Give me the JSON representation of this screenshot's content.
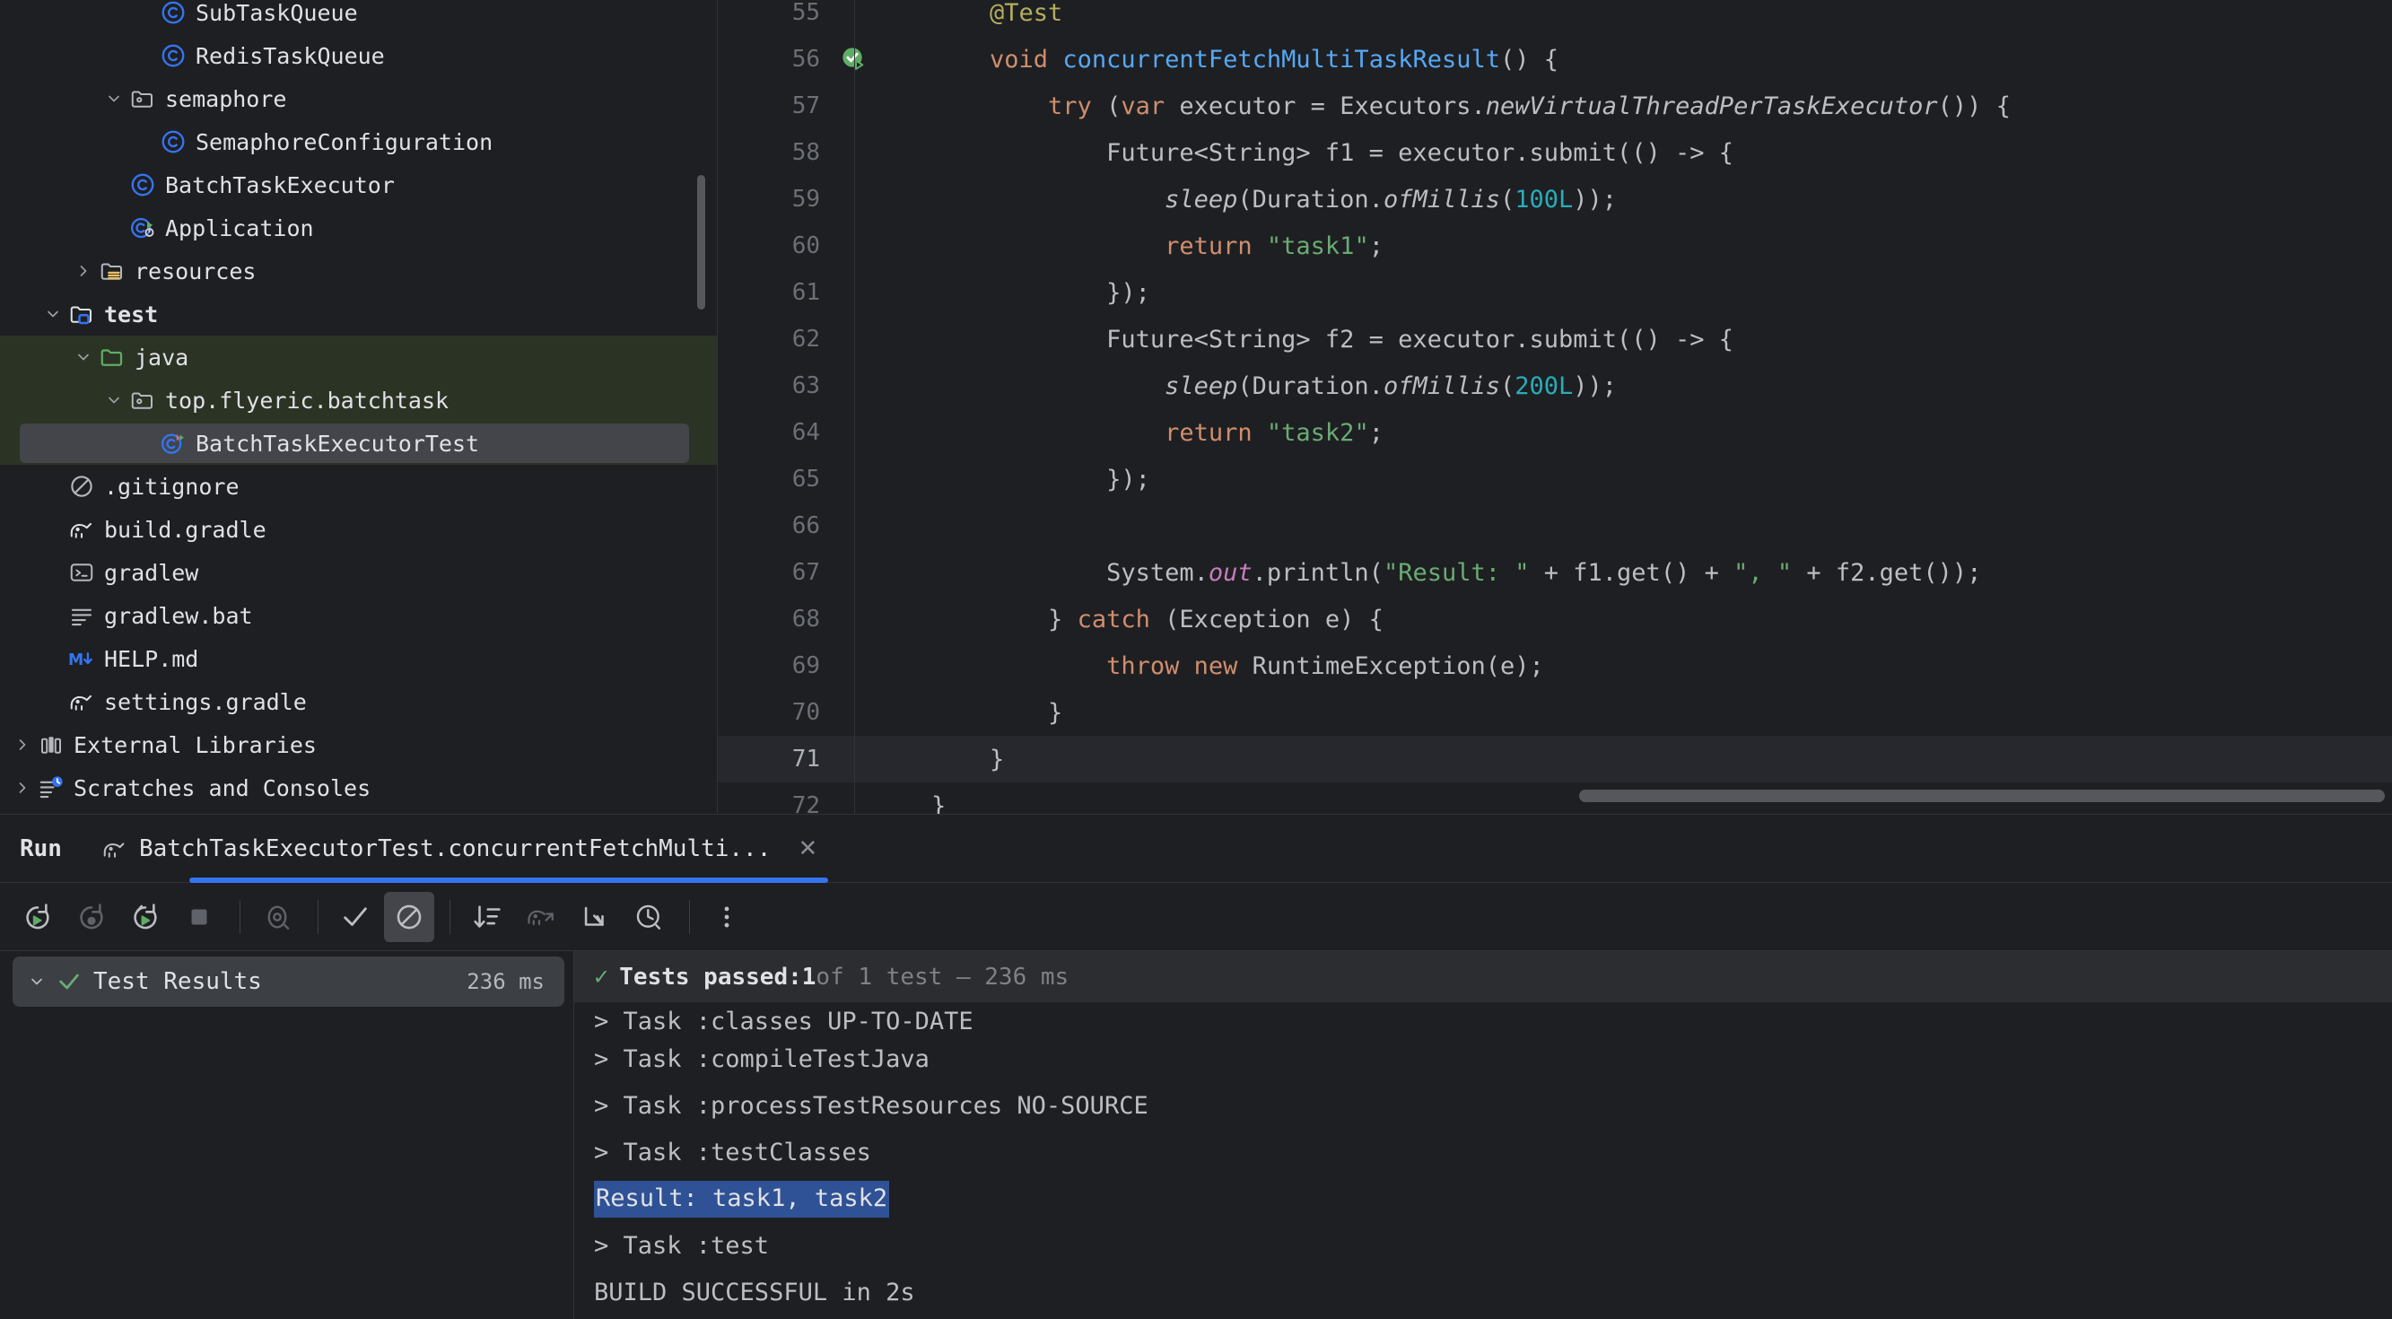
{
  "project_tree": {
    "items": [
      {
        "indent": 4,
        "arrow": "none",
        "icon": "class-icon",
        "label": "SubTaskQueue",
        "state": "normal",
        "clipped": true
      },
      {
        "indent": 4,
        "arrow": "none",
        "icon": "class-icon",
        "label": "RedisTaskQueue",
        "state": "normal"
      },
      {
        "indent": 3,
        "arrow": "down",
        "icon": "package-folder-icon",
        "label": "semaphore",
        "state": "normal"
      },
      {
        "indent": 4,
        "arrow": "none",
        "icon": "class-icon",
        "label": "SemaphoreConfiguration",
        "state": "normal"
      },
      {
        "indent": 3,
        "arrow": "none",
        "icon": "class-icon",
        "label": "BatchTaskExecutor",
        "state": "normal"
      },
      {
        "indent": 3,
        "arrow": "none",
        "icon": "runnable-class-icon",
        "label": "Application",
        "state": "normal"
      },
      {
        "indent": 2,
        "arrow": "right",
        "icon": "resources-folder-icon",
        "label": "resources",
        "state": "normal"
      },
      {
        "indent": 1,
        "arrow": "down",
        "icon": "test-source-folder-icon",
        "label": "test",
        "state": "bold"
      },
      {
        "indent": 2,
        "arrow": "down",
        "icon": "test-java-folder-icon",
        "label": "java",
        "state": "green-row"
      },
      {
        "indent": 3,
        "arrow": "down",
        "icon": "package-folder-icon",
        "label": "top.flyeric.batchtask",
        "state": "green-row"
      },
      {
        "indent": 4,
        "arrow": "none",
        "icon": "test-class-icon",
        "label": "BatchTaskExecutorTest",
        "state": "selected"
      },
      {
        "indent": 1,
        "arrow": "none",
        "icon": "gitignore-icon",
        "label": ".gitignore",
        "state": "normal"
      },
      {
        "indent": 1,
        "arrow": "none",
        "icon": "gradle-icon",
        "label": "build.gradle",
        "state": "normal"
      },
      {
        "indent": 1,
        "arrow": "none",
        "icon": "shell-script-icon",
        "label": "gradlew",
        "state": "normal"
      },
      {
        "indent": 1,
        "arrow": "none",
        "icon": "text-file-icon",
        "label": "gradlew.bat",
        "state": "normal"
      },
      {
        "indent": 1,
        "arrow": "none",
        "icon": "markdown-icon",
        "label": "HELP.md",
        "state": "normal"
      },
      {
        "indent": 1,
        "arrow": "none",
        "icon": "gradle-icon",
        "label": "settings.gradle",
        "state": "normal"
      },
      {
        "indent": 0,
        "arrow": "right",
        "icon": "external-libraries-icon",
        "label": "External Libraries",
        "state": "normal"
      },
      {
        "indent": 0,
        "arrow": "right",
        "icon": "scratches-icon",
        "label": "Scratches and Consoles",
        "state": "normal"
      }
    ]
  },
  "editor": {
    "lines": [
      {
        "num": "55",
        "gutter": "none",
        "current": false,
        "clipped_top": true,
        "tokens": [
          {
            "t": "    ",
            "c": "pl"
          },
          {
            "t": "@Test",
            "c": "ann"
          }
        ]
      },
      {
        "num": "56",
        "gutter": "run-test-success",
        "current": false,
        "tokens": [
          {
            "t": "    ",
            "c": "pl"
          },
          {
            "t": "void",
            "c": "kw"
          },
          {
            "t": " ",
            "c": "pl"
          },
          {
            "t": "concurrentFetchMultiTaskResult",
            "c": "fn"
          },
          {
            "t": "() {",
            "c": "pl"
          }
        ]
      },
      {
        "num": "57",
        "gutter": "none",
        "current": false,
        "tokens": [
          {
            "t": "        ",
            "c": "pl"
          },
          {
            "t": "try",
            "c": "kw"
          },
          {
            "t": " (",
            "c": "pl"
          },
          {
            "t": "var",
            "c": "kw"
          },
          {
            "t": " executor = Executors.",
            "c": "pl"
          },
          {
            "t": "newVirtualThreadPerTaskExecutor",
            "c": "ital"
          },
          {
            "t": "()) {",
            "c": "pl"
          }
        ]
      },
      {
        "num": "58",
        "gutter": "none",
        "current": false,
        "tokens": [
          {
            "t": "            Future<String> f1 = executor.submit(() -> {",
            "c": "pl"
          }
        ]
      },
      {
        "num": "59",
        "gutter": "none",
        "current": false,
        "tokens": [
          {
            "t": "                ",
            "c": "pl"
          },
          {
            "t": "sleep",
            "c": "ital"
          },
          {
            "t": "(Duration.",
            "c": "pl"
          },
          {
            "t": "ofMillis",
            "c": "ital"
          },
          {
            "t": "(",
            "c": "pl"
          },
          {
            "t": "100L",
            "c": "num"
          },
          {
            "t": "));",
            "c": "pl"
          }
        ]
      },
      {
        "num": "60",
        "gutter": "none",
        "current": false,
        "tokens": [
          {
            "t": "                ",
            "c": "pl"
          },
          {
            "t": "return",
            "c": "kw"
          },
          {
            "t": " ",
            "c": "pl"
          },
          {
            "t": "\"task1\"",
            "c": "str"
          },
          {
            "t": ";",
            "c": "pl"
          }
        ]
      },
      {
        "num": "61",
        "gutter": "none",
        "current": false,
        "tokens": [
          {
            "t": "            });",
            "c": "pl"
          }
        ]
      },
      {
        "num": "62",
        "gutter": "none",
        "current": false,
        "tokens": [
          {
            "t": "            Future<String> f2 = executor.submit(() -> {",
            "c": "pl"
          }
        ]
      },
      {
        "num": "63",
        "gutter": "none",
        "current": false,
        "tokens": [
          {
            "t": "                ",
            "c": "pl"
          },
          {
            "t": "sleep",
            "c": "ital"
          },
          {
            "t": "(Duration.",
            "c": "pl"
          },
          {
            "t": "ofMillis",
            "c": "ital"
          },
          {
            "t": "(",
            "c": "pl"
          },
          {
            "t": "200L",
            "c": "num"
          },
          {
            "t": "));",
            "c": "pl"
          }
        ]
      },
      {
        "num": "64",
        "gutter": "none",
        "current": false,
        "tokens": [
          {
            "t": "                ",
            "c": "pl"
          },
          {
            "t": "return",
            "c": "kw"
          },
          {
            "t": " ",
            "c": "pl"
          },
          {
            "t": "\"task2\"",
            "c": "str"
          },
          {
            "t": ";",
            "c": "pl"
          }
        ]
      },
      {
        "num": "65",
        "gutter": "none",
        "current": false,
        "tokens": [
          {
            "t": "            });",
            "c": "pl"
          }
        ]
      },
      {
        "num": "66",
        "gutter": "none",
        "current": false,
        "tokens": [
          {
            "t": "",
            "c": "pl"
          }
        ]
      },
      {
        "num": "67",
        "gutter": "none",
        "current": false,
        "tokens": [
          {
            "t": "            System.",
            "c": "pl"
          },
          {
            "t": "out",
            "c": "fld"
          },
          {
            "t": ".println(",
            "c": "pl"
          },
          {
            "t": "\"Result: \"",
            "c": "str"
          },
          {
            "t": " + f1.get() + ",
            "c": "pl"
          },
          {
            "t": "\", \"",
            "c": "str"
          },
          {
            "t": " + f2.get());",
            "c": "pl"
          }
        ]
      },
      {
        "num": "68",
        "gutter": "none",
        "current": false,
        "tokens": [
          {
            "t": "        } ",
            "c": "pl"
          },
          {
            "t": "catch",
            "c": "kw"
          },
          {
            "t": " (Exception e) {",
            "c": "pl"
          }
        ]
      },
      {
        "num": "69",
        "gutter": "none",
        "current": false,
        "tokens": [
          {
            "t": "            ",
            "c": "pl"
          },
          {
            "t": "throw",
            "c": "kw"
          },
          {
            "t": " ",
            "c": "pl"
          },
          {
            "t": "new",
            "c": "kw"
          },
          {
            "t": " RuntimeException(e);",
            "c": "pl"
          }
        ]
      },
      {
        "num": "70",
        "gutter": "none",
        "current": false,
        "tokens": [
          {
            "t": "        }",
            "c": "pl"
          }
        ]
      },
      {
        "num": "71",
        "gutter": "none",
        "current": true,
        "tokens": [
          {
            "t": "    }",
            "c": "pl"
          }
        ]
      },
      {
        "num": "72",
        "gutter": "none",
        "current": false,
        "clipped_bottom": true,
        "tokens": [
          {
            "t": "}",
            "c": "pl"
          }
        ]
      }
    ]
  },
  "run_panel": {
    "title": "Run",
    "tab": {
      "icon": "gradle-icon",
      "label": "BatchTaskExecutorTest.concurrentFetchMulti...",
      "close_label": "✕"
    },
    "toolbar": [
      {
        "name": "rerun-button",
        "icon": "rerun",
        "state": "normal"
      },
      {
        "name": "rerun-failed-button",
        "icon": "rerun-failed",
        "state": "disabled"
      },
      {
        "name": "toggle-auto-test-button",
        "icon": "auto-test",
        "state": "normal"
      },
      {
        "name": "stop-button",
        "icon": "stop",
        "state": "disabled"
      },
      {
        "name": "separator",
        "icon": "sep",
        "state": "sep"
      },
      {
        "name": "show-passed-button",
        "icon": "eye",
        "state": "dim"
      },
      {
        "name": "separator",
        "icon": "sep",
        "state": "sep"
      },
      {
        "name": "show-passed-check-button",
        "icon": "check",
        "state": "normal"
      },
      {
        "name": "hide-ignored-button",
        "icon": "block",
        "state": "active"
      },
      {
        "name": "separator",
        "icon": "sep",
        "state": "sep"
      },
      {
        "name": "sort-button",
        "icon": "sort",
        "state": "normal"
      },
      {
        "name": "export-gradle-button",
        "icon": "gradle-export",
        "state": "dim"
      },
      {
        "name": "expand-collapse-button",
        "icon": "collapse",
        "state": "normal"
      },
      {
        "name": "history-button",
        "icon": "clock",
        "state": "normal"
      },
      {
        "name": "separator",
        "icon": "sep",
        "state": "sep"
      },
      {
        "name": "more-options-button",
        "icon": "kebab",
        "state": "normal"
      }
    ],
    "test_tree": {
      "root_label": "Test Results",
      "root_duration": "236 ms"
    },
    "console": {
      "summary": {
        "passed_label": "Tests passed: ",
        "passed_count": "1",
        "rest": " of 1 test — 236 ms"
      },
      "lines": [
        {
          "text": "> Task :classes UP-TO-DATE",
          "highlight": false,
          "clipped": true
        },
        {
          "text": "> Task :compileTestJava",
          "highlight": false
        },
        {
          "text": "> Task :processTestResources NO-SOURCE",
          "highlight": false
        },
        {
          "text": "> Task :testClasses",
          "highlight": false
        },
        {
          "text": "Result: task1, task2",
          "highlight": true
        },
        {
          "text": "> Task :test",
          "highlight": false
        },
        {
          "text": "BUILD SUCCESSFUL in 2s",
          "highlight": false
        }
      ]
    }
  },
  "colors": {
    "background": "#1e1f22",
    "panel": "#2b2d30",
    "selection": "#43454a",
    "accent": "#3574f0",
    "test_source_green": "#2b3324",
    "console_highlight": "#2f5195",
    "success_green": "#6aab73",
    "keyword_orange": "#cf8e6d",
    "method_blue": "#56a8f5",
    "number_cyan": "#2aacb8",
    "annotation_olive": "#b3ae60"
  }
}
